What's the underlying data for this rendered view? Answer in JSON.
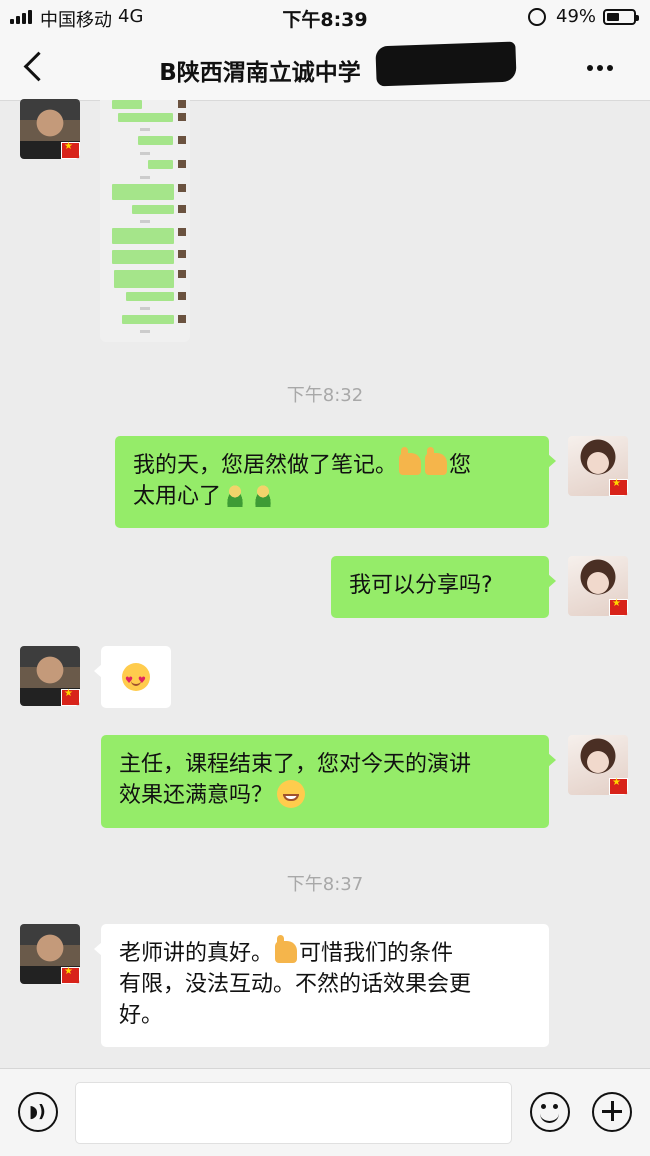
{
  "status_bar": {
    "carrier": "中国移动",
    "network": "4G",
    "time": "下午8:39",
    "battery": "49%",
    "battery_level": 0.49
  },
  "nav": {
    "title": "B陕西渭南立诚中学"
  },
  "messages": [
    {
      "sender": "other",
      "type": "image"
    },
    {
      "type": "timestamp",
      "text": "下午8:32"
    },
    {
      "sender": "self",
      "line1": "我的天，您居然做了笔记。",
      "line1_tail": "您",
      "line2": "太用心了"
    },
    {
      "sender": "self",
      "text": "我可以分享吗?"
    },
    {
      "sender": "other",
      "type": "emoji"
    },
    {
      "sender": "self",
      "line1": "主任，课程结束了，您对今天的演讲",
      "line2": "效果还满意吗？"
    },
    {
      "type": "timestamp",
      "text": "下午8:37"
    },
    {
      "sender": "other",
      "line1a": "老师讲的真好。",
      "line1b": "可惜我们的条件",
      "line2": "有限，没法互动。不然的话效果会更",
      "line3": "好。"
    }
  ],
  "colors": {
    "self_bubble": "#95ec69",
    "other_bubble": "#ffffff",
    "background": "#ececec"
  },
  "icons": {
    "voice": "voice-icon",
    "emoji": "emoji-icon",
    "plus": "plus-icon"
  }
}
